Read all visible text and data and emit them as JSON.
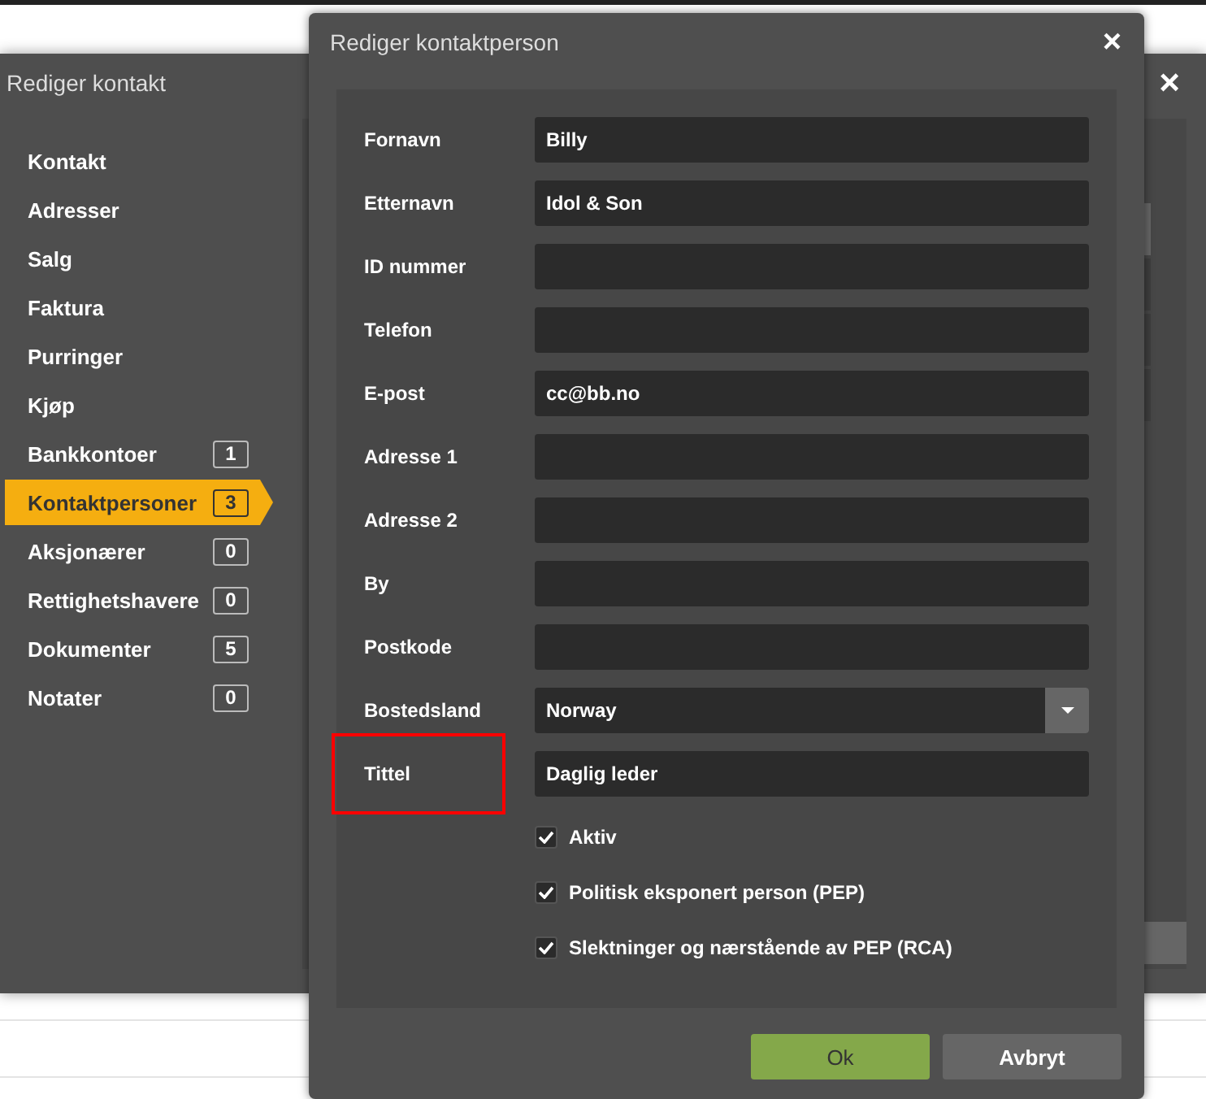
{
  "back_dialog": {
    "title": "Rediger kontakt",
    "close": "×",
    "nav": [
      {
        "label": "Kontakt",
        "selected": false
      },
      {
        "label": "Adresser",
        "selected": false
      },
      {
        "label": "Salg",
        "selected": false
      },
      {
        "label": "Faktura",
        "selected": false
      },
      {
        "label": "Purringer",
        "selected": false
      },
      {
        "label": "Kjøp",
        "selected": false
      },
      {
        "label": "Bankkontoer",
        "count": "1",
        "selected": false
      },
      {
        "label": "Kontaktpersoner",
        "count": "3",
        "selected": true
      },
      {
        "label": "Aksjonærer",
        "count": "0",
        "selected": false
      },
      {
        "label": "Rettighetshavere",
        "count": "0",
        "selected": false
      },
      {
        "label": "Dokumenter",
        "count": "5",
        "selected": false
      },
      {
        "label": "Notater",
        "count": "0",
        "selected": false
      }
    ]
  },
  "dialog": {
    "title": "Rediger kontaktperson",
    "close": "×",
    "fields": [
      {
        "label": "Fornavn",
        "kind": "text",
        "value": "Billy",
        "highlighted": false
      },
      {
        "label": "Etternavn",
        "kind": "text",
        "value": "Idol & Son",
        "highlighted": false
      },
      {
        "label": "ID nummer",
        "kind": "text",
        "highlighted": false
      },
      {
        "label": "Telefon",
        "kind": "text",
        "highlighted": false
      },
      {
        "label": "E-post",
        "kind": "text",
        "value": "cc@bb.no",
        "highlighted": false
      },
      {
        "label": "Adresse 1",
        "kind": "text",
        "highlighted": false
      },
      {
        "label": "Adresse 2",
        "kind": "text",
        "highlighted": false
      },
      {
        "label": "By",
        "kind": "text",
        "highlighted": false
      },
      {
        "label": "Postkode",
        "kind": "text",
        "highlighted": false
      },
      {
        "label": "Bostedsland",
        "kind": "select",
        "value": "Norway",
        "highlighted": false
      },
      {
        "label": "Tittel",
        "kind": "text",
        "value": "Daglig leder",
        "highlighted": true
      }
    ],
    "checkboxes": [
      {
        "label": "Aktiv",
        "checked": true
      },
      {
        "label": "Politisk eksponert person (PEP)",
        "checked": true
      },
      {
        "label": "Slektninger og nærstående av PEP (RCA)",
        "checked": true
      }
    ],
    "buttons": [
      {
        "label": "Ok",
        "kind": "primary"
      },
      {
        "label": "Avbryt",
        "kind": "secondary"
      }
    ]
  }
}
